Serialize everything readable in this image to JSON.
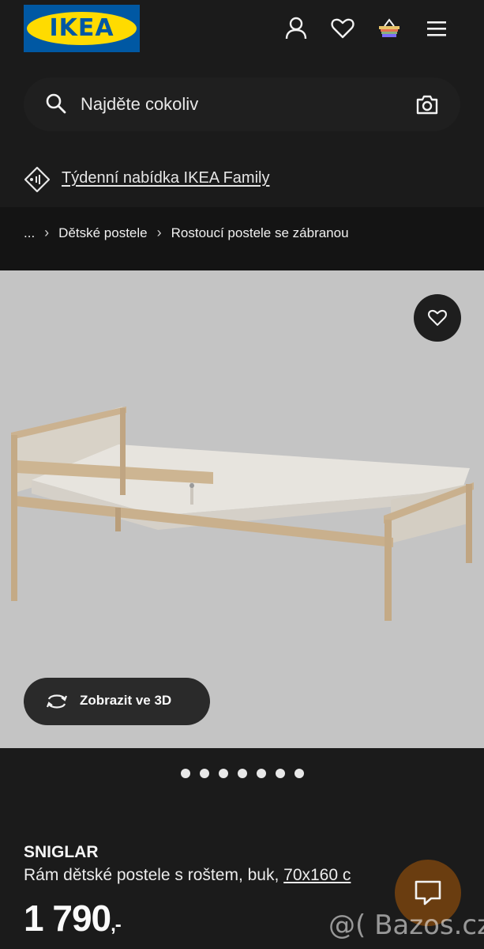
{
  "header": {
    "logo_text": "IKEA",
    "icons": [
      "user-icon",
      "heart-icon",
      "basket-icon",
      "menu-icon"
    ]
  },
  "search": {
    "placeholder": "Najděte cokoliv"
  },
  "family_offer": {
    "label": "Týdenní nabídka IKEA Family"
  },
  "breadcrumb": {
    "items": [
      "...",
      "Dětské postele",
      "Rostoucí postele se zábranou"
    ]
  },
  "gallery": {
    "view3d_label": "Zobrazit ve 3D",
    "dots_count": 7
  },
  "product": {
    "name": "SNIGLAR",
    "description": "Rám dětské postele s roštem, buk, ",
    "size": "70x160 c",
    "price": "1 790",
    "price_suffix": ",-"
  },
  "watermark": "@( Bazos.cz",
  "colors": {
    "background": "#1b1b1b",
    "gallery_bg": "#c4c4c4",
    "logo_blue": "#0058a3",
    "logo_yellow": "#ffdb00",
    "chat_button": "#6a3d10"
  }
}
